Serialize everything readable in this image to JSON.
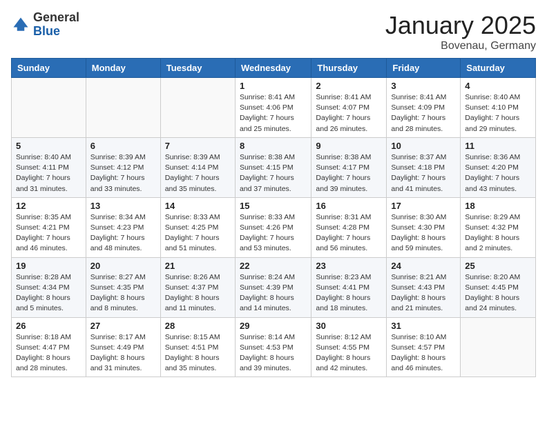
{
  "header": {
    "logo_general": "General",
    "logo_blue": "Blue",
    "month_title": "January 2025",
    "location": "Bovenau, Germany"
  },
  "weekdays": [
    "Sunday",
    "Monday",
    "Tuesday",
    "Wednesday",
    "Thursday",
    "Friday",
    "Saturday"
  ],
  "weeks": [
    [
      {
        "day": "",
        "info": ""
      },
      {
        "day": "",
        "info": ""
      },
      {
        "day": "",
        "info": ""
      },
      {
        "day": "1",
        "info": "Sunrise: 8:41 AM\nSunset: 4:06 PM\nDaylight: 7 hours\nand 25 minutes."
      },
      {
        "day": "2",
        "info": "Sunrise: 8:41 AM\nSunset: 4:07 PM\nDaylight: 7 hours\nand 26 minutes."
      },
      {
        "day": "3",
        "info": "Sunrise: 8:41 AM\nSunset: 4:09 PM\nDaylight: 7 hours\nand 28 minutes."
      },
      {
        "day": "4",
        "info": "Sunrise: 8:40 AM\nSunset: 4:10 PM\nDaylight: 7 hours\nand 29 minutes."
      }
    ],
    [
      {
        "day": "5",
        "info": "Sunrise: 8:40 AM\nSunset: 4:11 PM\nDaylight: 7 hours\nand 31 minutes."
      },
      {
        "day": "6",
        "info": "Sunrise: 8:39 AM\nSunset: 4:12 PM\nDaylight: 7 hours\nand 33 minutes."
      },
      {
        "day": "7",
        "info": "Sunrise: 8:39 AM\nSunset: 4:14 PM\nDaylight: 7 hours\nand 35 minutes."
      },
      {
        "day": "8",
        "info": "Sunrise: 8:38 AM\nSunset: 4:15 PM\nDaylight: 7 hours\nand 37 minutes."
      },
      {
        "day": "9",
        "info": "Sunrise: 8:38 AM\nSunset: 4:17 PM\nDaylight: 7 hours\nand 39 minutes."
      },
      {
        "day": "10",
        "info": "Sunrise: 8:37 AM\nSunset: 4:18 PM\nDaylight: 7 hours\nand 41 minutes."
      },
      {
        "day": "11",
        "info": "Sunrise: 8:36 AM\nSunset: 4:20 PM\nDaylight: 7 hours\nand 43 minutes."
      }
    ],
    [
      {
        "day": "12",
        "info": "Sunrise: 8:35 AM\nSunset: 4:21 PM\nDaylight: 7 hours\nand 46 minutes."
      },
      {
        "day": "13",
        "info": "Sunrise: 8:34 AM\nSunset: 4:23 PM\nDaylight: 7 hours\nand 48 minutes."
      },
      {
        "day": "14",
        "info": "Sunrise: 8:33 AM\nSunset: 4:25 PM\nDaylight: 7 hours\nand 51 minutes."
      },
      {
        "day": "15",
        "info": "Sunrise: 8:33 AM\nSunset: 4:26 PM\nDaylight: 7 hours\nand 53 minutes."
      },
      {
        "day": "16",
        "info": "Sunrise: 8:31 AM\nSunset: 4:28 PM\nDaylight: 7 hours\nand 56 minutes."
      },
      {
        "day": "17",
        "info": "Sunrise: 8:30 AM\nSunset: 4:30 PM\nDaylight: 8 hours\nand 59 minutes."
      },
      {
        "day": "18",
        "info": "Sunrise: 8:29 AM\nSunset: 4:32 PM\nDaylight: 8 hours\nand 2 minutes."
      }
    ],
    [
      {
        "day": "19",
        "info": "Sunrise: 8:28 AM\nSunset: 4:34 PM\nDaylight: 8 hours\nand 5 minutes."
      },
      {
        "day": "20",
        "info": "Sunrise: 8:27 AM\nSunset: 4:35 PM\nDaylight: 8 hours\nand 8 minutes."
      },
      {
        "day": "21",
        "info": "Sunrise: 8:26 AM\nSunset: 4:37 PM\nDaylight: 8 hours\nand 11 minutes."
      },
      {
        "day": "22",
        "info": "Sunrise: 8:24 AM\nSunset: 4:39 PM\nDaylight: 8 hours\nand 14 minutes."
      },
      {
        "day": "23",
        "info": "Sunrise: 8:23 AM\nSunset: 4:41 PM\nDaylight: 8 hours\nand 18 minutes."
      },
      {
        "day": "24",
        "info": "Sunrise: 8:21 AM\nSunset: 4:43 PM\nDaylight: 8 hours\nand 21 minutes."
      },
      {
        "day": "25",
        "info": "Sunrise: 8:20 AM\nSunset: 4:45 PM\nDaylight: 8 hours\nand 24 minutes."
      }
    ],
    [
      {
        "day": "26",
        "info": "Sunrise: 8:18 AM\nSunset: 4:47 PM\nDaylight: 8 hours\nand 28 minutes."
      },
      {
        "day": "27",
        "info": "Sunrise: 8:17 AM\nSunset: 4:49 PM\nDaylight: 8 hours\nand 31 minutes."
      },
      {
        "day": "28",
        "info": "Sunrise: 8:15 AM\nSunset: 4:51 PM\nDaylight: 8 hours\nand 35 minutes."
      },
      {
        "day": "29",
        "info": "Sunrise: 8:14 AM\nSunset: 4:53 PM\nDaylight: 8 hours\nand 39 minutes."
      },
      {
        "day": "30",
        "info": "Sunrise: 8:12 AM\nSunset: 4:55 PM\nDaylight: 8 hours\nand 42 minutes."
      },
      {
        "day": "31",
        "info": "Sunrise: 8:10 AM\nSunset: 4:57 PM\nDaylight: 8 hours\nand 46 minutes."
      },
      {
        "day": "",
        "info": ""
      }
    ]
  ]
}
